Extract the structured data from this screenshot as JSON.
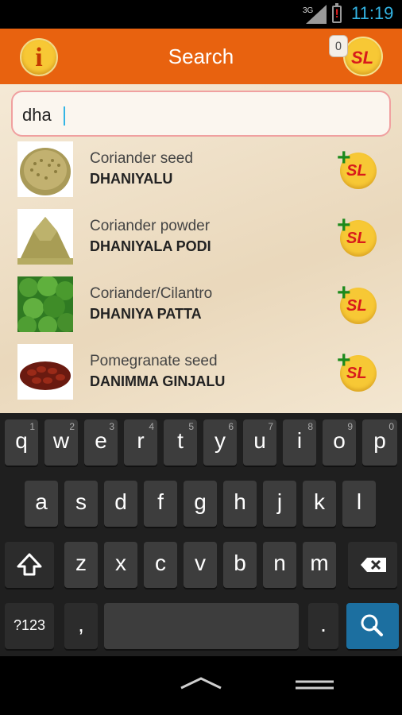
{
  "status_bar": {
    "network": "3G",
    "time": "11:19",
    "battery_alert": "!"
  },
  "header": {
    "title": "Search",
    "info_icon_label": "i",
    "cart_count": "0",
    "cart_logo": "SL"
  },
  "search": {
    "value": "dha"
  },
  "results": [
    {
      "name": "Coriander seed",
      "local_name": "DHANIYALU",
      "thumb": "coriander-seed-image",
      "add_logo": "SL"
    },
    {
      "name": "Coriander powder",
      "local_name": "DHANIYALA PODI",
      "thumb": "coriander-powder-image",
      "add_logo": "SL"
    },
    {
      "name": "Coriander/Cilantro",
      "local_name": "DHANIYA PATTA",
      "thumb": "cilantro-image",
      "add_logo": "SL"
    },
    {
      "name": "Pomegranate seed",
      "local_name": "DANIMMA GINJALU",
      "thumb": "pomegranate-seed-image",
      "add_logo": "SL"
    }
  ],
  "keyboard": {
    "row1": [
      {
        "k": "q",
        "h": "1"
      },
      {
        "k": "w",
        "h": "2"
      },
      {
        "k": "e",
        "h": "3"
      },
      {
        "k": "r",
        "h": "4"
      },
      {
        "k": "t",
        "h": "5"
      },
      {
        "k": "y",
        "h": "6"
      },
      {
        "k": "u",
        "h": "7"
      },
      {
        "k": "i",
        "h": "8"
      },
      {
        "k": "o",
        "h": "9"
      },
      {
        "k": "p",
        "h": "0"
      }
    ],
    "row2": [
      "a",
      "s",
      "d",
      "f",
      "g",
      "h",
      "j",
      "k",
      "l"
    ],
    "row3": [
      "z",
      "x",
      "c",
      "v",
      "b",
      "n",
      "m"
    ],
    "symbols": "?123",
    "comma": ",",
    "period": "."
  },
  "colors": {
    "action_bar": "#e8620f",
    "accent": "#33b5e5",
    "coin": "#f7c835",
    "logo_red": "#d81b1b",
    "plus_green": "#1c8a1c"
  }
}
